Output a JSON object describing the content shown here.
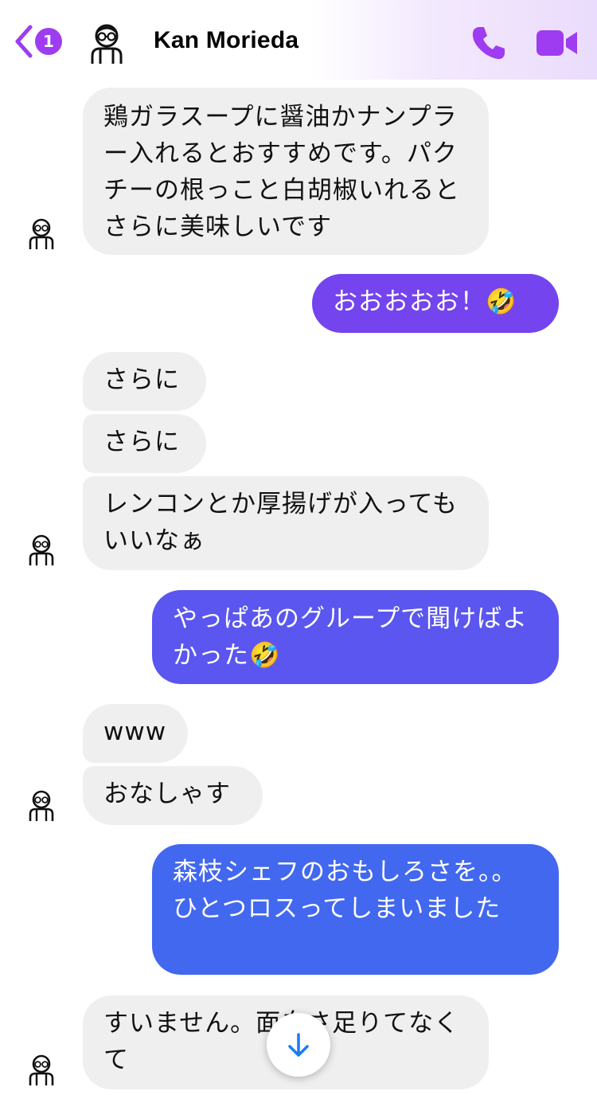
{
  "header": {
    "unread_count": "1",
    "contact_name": "Kan Morieda"
  },
  "colors": {
    "accent": "#9d3cf0",
    "incoming_bubble": "#efefef"
  },
  "icons": {
    "back": "chevron-left-icon",
    "call": "phone-icon",
    "video": "video-camera-icon",
    "scroll": "arrow-down-icon"
  },
  "messages": [
    {
      "from": "them",
      "text": "鶏ガラスープに醤油かナンプラー入れるとおすすめです。パクチーの根っこと白胡椒いれるとさらに美味しいです"
    },
    {
      "from": "me",
      "text": "おおおおお！🤣"
    },
    {
      "from": "them",
      "text": "さらに"
    },
    {
      "from": "them",
      "text": "さらに"
    },
    {
      "from": "them",
      "text": "レンコンとか厚揚げが入ってもいいなぁ"
    },
    {
      "from": "me",
      "text": "やっぱあのグループで聞けばよかった🤣"
    },
    {
      "from": "them",
      "text": "www"
    },
    {
      "from": "them",
      "text": "おなしゃす"
    },
    {
      "from": "me",
      "text": "森枝シェフのおもしろさを。。ひとつロスってしまいました"
    },
    {
      "from": "them",
      "text": "すいません。面白さ足りてなくて"
    }
  ]
}
